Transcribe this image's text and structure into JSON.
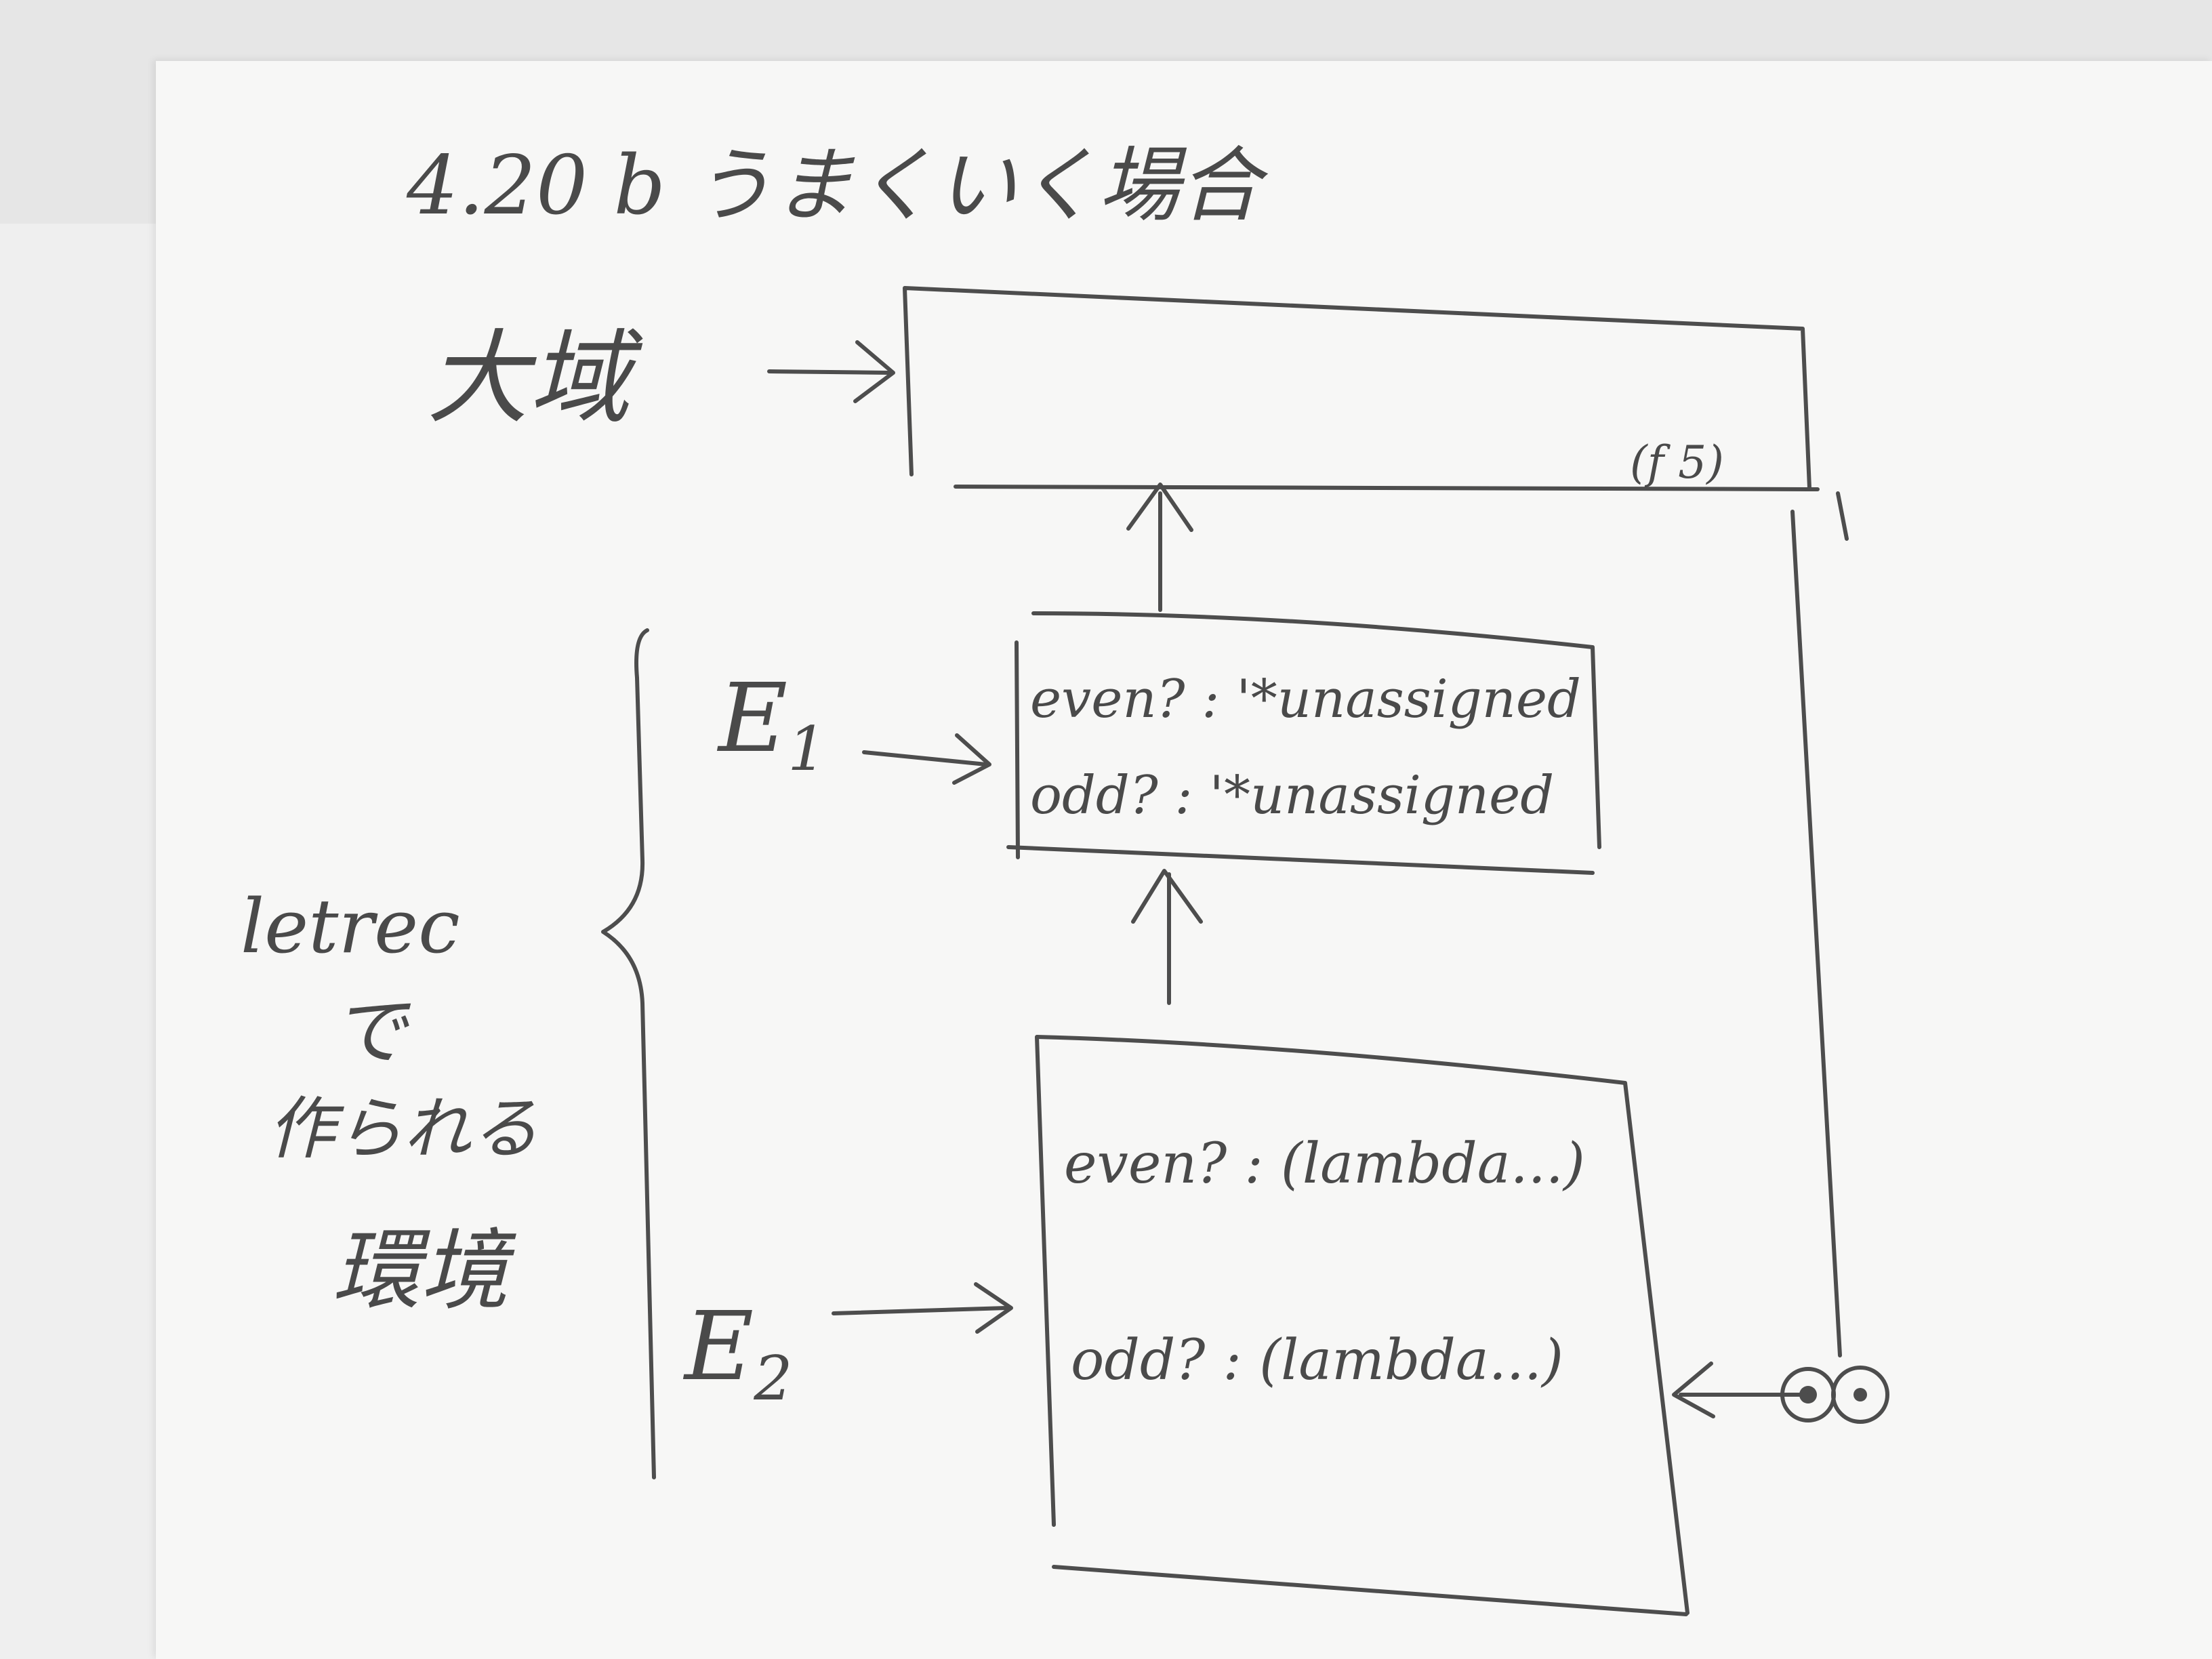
{
  "title": "4.20 b うまくいく場合",
  "global_env": {
    "label": "大域",
    "content": "(f 5)"
  },
  "e1": {
    "label": "E",
    "label_sub": "1",
    "bindings": [
      "even? : '*unassigned",
      "odd? : '*unassigned"
    ]
  },
  "e2": {
    "label": "E",
    "label_sub": "2",
    "bindings": [
      "even? : (lambda...)",
      "odd? : (lambda...)"
    ]
  },
  "letrec_note": {
    "line1": "letrec",
    "line2": "で",
    "line3": "作られる",
    "line4": "環境"
  }
}
